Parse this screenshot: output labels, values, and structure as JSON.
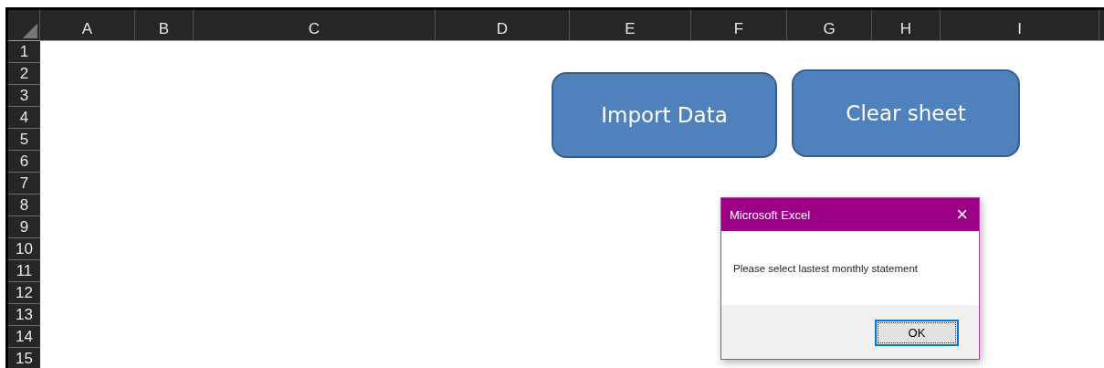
{
  "columns": [
    "A",
    "B",
    "C",
    "D",
    "E",
    "F",
    "G",
    "H",
    "I"
  ],
  "rows": [
    "1",
    "2",
    "3",
    "4",
    "5",
    "6",
    "7",
    "8",
    "9",
    "10",
    "11",
    "12",
    "13",
    "14",
    "15"
  ],
  "shape_buttons": [
    {
      "label": "Import Data"
    },
    {
      "label": "Clear sheet"
    }
  ],
  "dialog": {
    "title": "Microsoft Excel",
    "close": "×",
    "message": "Please select lastest monthly statement",
    "button": "OK"
  }
}
